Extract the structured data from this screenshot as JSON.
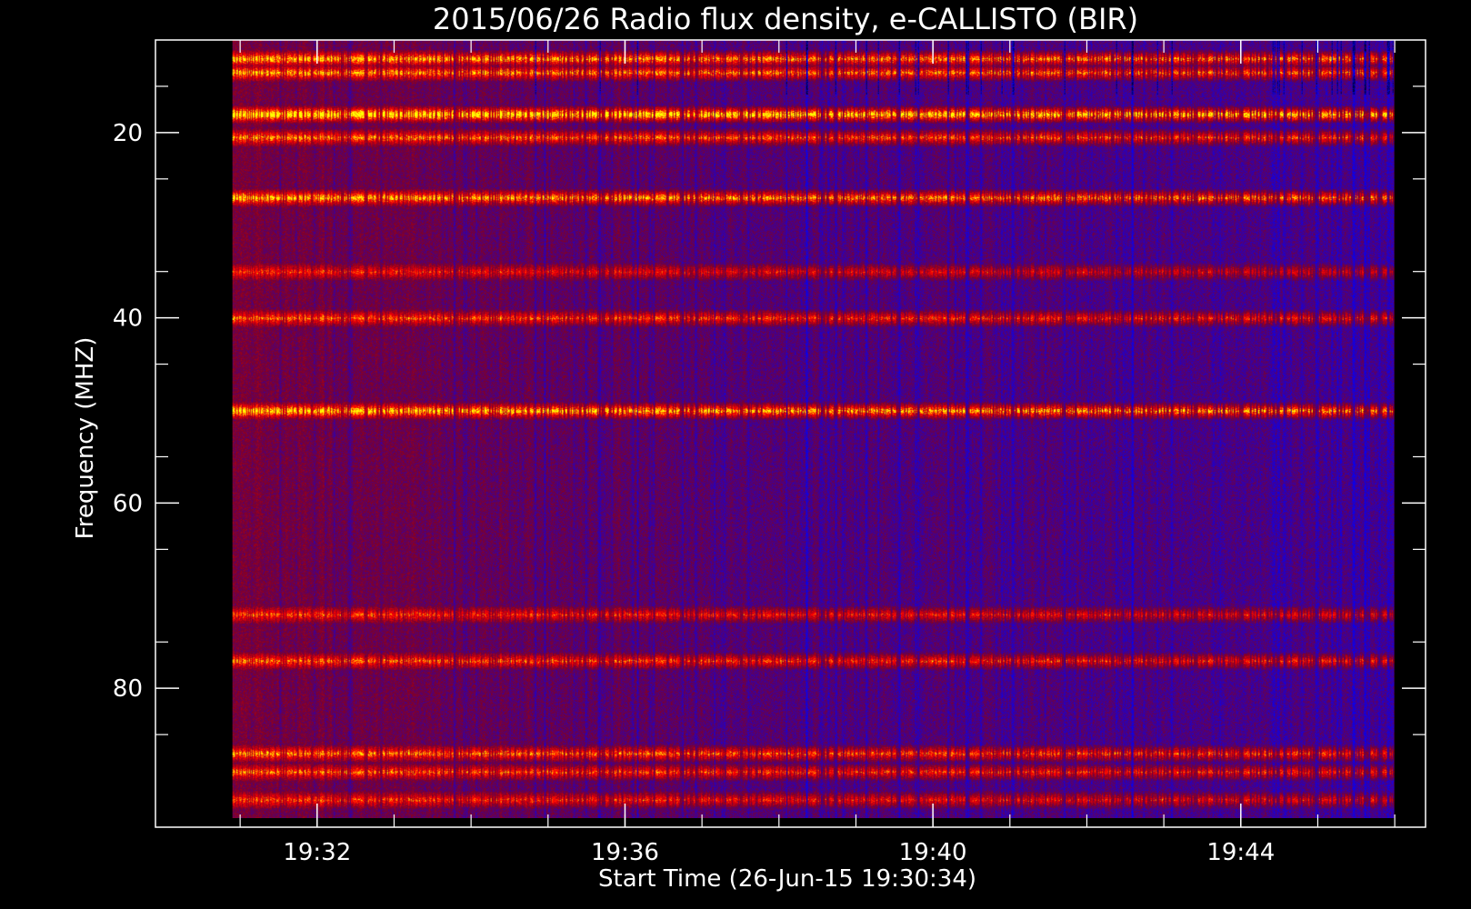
{
  "chart_data": {
    "type": "heatmap",
    "title": "2015/06/26  Radio flux density, e-CALLISTO (BIR)",
    "xlabel": "Start Time (26-Jun-15 19:30:34)",
    "ylabel": "Frequency (MHZ)",
    "x_ticks": [
      {
        "value": "19:32",
        "minutes": 1.433
      },
      {
        "value": "19:36",
        "minutes": 5.433
      },
      {
        "value": "19:40",
        "minutes": 9.433
      },
      {
        "value": "19:44",
        "minutes": 13.433
      }
    ],
    "y_ticks": [
      20,
      40,
      60,
      80
    ],
    "xlim": [
      "19:29:54",
      "19:46:24"
    ],
    "ylim": [
      95,
      10
    ],
    "data_extent": {
      "time_start": "19:30:54",
      "time_end": "19:46:00",
      "freq_min_mhz": 10,
      "freq_max_mhz": 94
    },
    "colorscale": [
      "#000000",
      "#0000ff",
      "#800000",
      "#ff0000",
      "#ffff00"
    ],
    "interference_bands_mhz": [
      {
        "freq": 12,
        "level": 0.7
      },
      {
        "freq": 13.5,
        "level": 0.65
      },
      {
        "freq": 18,
        "level": 0.85
      },
      {
        "freq": 20.5,
        "level": 0.6
      },
      {
        "freq": 27,
        "level": 0.7
      },
      {
        "freq": 35,
        "level": 0.45
      },
      {
        "freq": 40,
        "level": 0.55
      },
      {
        "freq": 50,
        "level": 0.75
      },
      {
        "freq": 72,
        "level": 0.5
      },
      {
        "freq": 77,
        "level": 0.55
      },
      {
        "freq": 87,
        "level": 0.6
      },
      {
        "freq": 89,
        "level": 0.55
      },
      {
        "freq": 92,
        "level": 0.5
      }
    ],
    "grid": false,
    "background": "#000000",
    "axis_color": "#ffffff"
  }
}
